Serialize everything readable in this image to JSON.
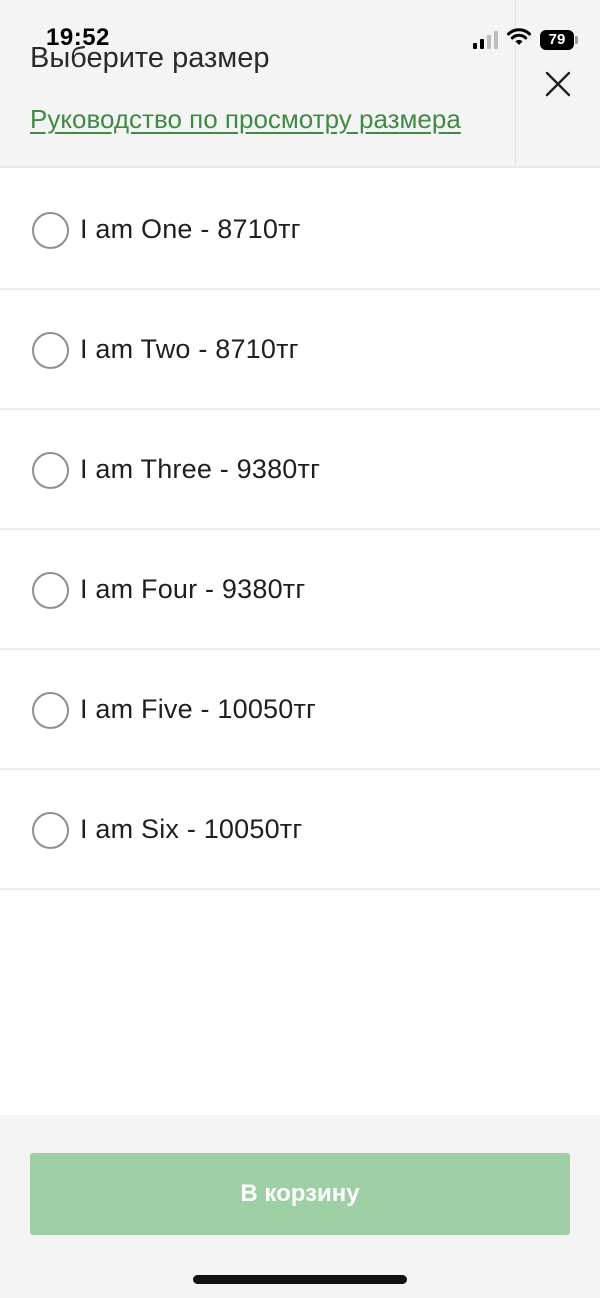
{
  "status_bar": {
    "time": "19:52",
    "battery": "79",
    "icons": [
      "cellular-signal-icon",
      "wifi-icon",
      "battery-icon"
    ]
  },
  "header": {
    "title": "Выберите размер",
    "guide_link": "Руководство по просмотру размера",
    "close_icon": "close-icon",
    "link_color": "#3f8a45"
  },
  "sizes": [
    {
      "label": "I am One - 8710тг",
      "selected": false
    },
    {
      "label": "I am Two - 8710тг",
      "selected": false
    },
    {
      "label": "I am Three - 9380тг",
      "selected": false
    },
    {
      "label": "I am Four - 9380тг",
      "selected": false
    },
    {
      "label": "I am Five - 10050тг",
      "selected": false
    },
    {
      "label": "I am Six - 10050тг",
      "selected": false
    }
  ],
  "footer": {
    "add_to_cart_label": "В корзину",
    "button_color": "#9fcfa5",
    "button_state": "disabled"
  }
}
